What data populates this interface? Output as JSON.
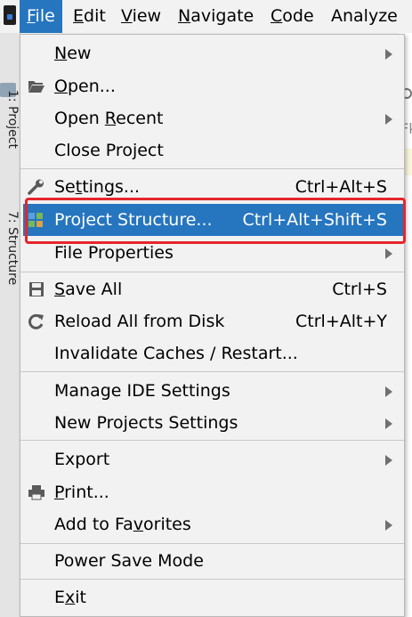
{
  "menubar": {
    "items": [
      {
        "pre": "",
        "u": "F",
        "post": "ile"
      },
      {
        "pre": "",
        "u": "E",
        "post": "dit"
      },
      {
        "pre": "",
        "u": "V",
        "post": "iew"
      },
      {
        "pre": "",
        "u": "N",
        "post": "avigate"
      },
      {
        "pre": "",
        "u": "C",
        "post": "ode"
      },
      {
        "pre": "",
        "u": "",
        "post": "Analyze"
      }
    ],
    "accent": "#2675bf"
  },
  "side": {
    "project_tab": "1: Project",
    "structure_tab": "7: Structure"
  },
  "editor_hints": [
    "Fk"
  ],
  "menu": {
    "items": [
      {
        "pre": "",
        "u": "N",
        "post": "ew",
        "shortcut": "",
        "submenu": true,
        "icon": ""
      },
      {
        "pre": "",
        "u": "O",
        "post": "pen...",
        "shortcut": "",
        "submenu": false,
        "icon": "folder-open-icon"
      },
      {
        "pre": "Open ",
        "u": "R",
        "post": "ecent",
        "shortcut": "",
        "submenu": true,
        "icon": ""
      },
      {
        "pre": "Close Project",
        "u": "",
        "post": "",
        "shortcut": "",
        "submenu": false,
        "icon": ""
      },
      {
        "pre": "Se",
        "u": "t",
        "post": "tings...",
        "shortcut": "Ctrl+Alt+S",
        "submenu": false,
        "icon": "wrench-icon"
      },
      {
        "pre": "Project Structure...",
        "u": "",
        "post": "",
        "shortcut": "Ctrl+Alt+Shift+S",
        "submenu": false,
        "icon": "project-structure-icon",
        "selected": true
      },
      {
        "pre": "File Properties",
        "u": "",
        "post": "",
        "shortcut": "",
        "submenu": true,
        "icon": ""
      },
      {
        "pre": "",
        "u": "S",
        "post": "ave All",
        "shortcut": "Ctrl+S",
        "submenu": false,
        "icon": "save-icon"
      },
      {
        "pre": "Reload All from Disk",
        "u": "",
        "post": "",
        "shortcut": "Ctrl+Alt+Y",
        "submenu": false,
        "icon": "reload-icon"
      },
      {
        "pre": "Invalidate Caches / Restart...",
        "u": "",
        "post": "",
        "shortcut": "",
        "submenu": false,
        "icon": ""
      },
      {
        "pre": "Manage IDE Settings",
        "u": "",
        "post": "",
        "shortcut": "",
        "submenu": true,
        "icon": ""
      },
      {
        "pre": "New Projects Settings",
        "u": "",
        "post": "",
        "shortcut": "",
        "submenu": true,
        "icon": ""
      },
      {
        "pre": "Export",
        "u": "",
        "post": "",
        "shortcut": "",
        "submenu": true,
        "icon": ""
      },
      {
        "pre": "",
        "u": "P",
        "post": "rint...",
        "shortcut": "",
        "submenu": false,
        "icon": "print-icon"
      },
      {
        "pre": "Add to Fa",
        "u": "v",
        "post": "orites",
        "shortcut": "",
        "submenu": true,
        "icon": ""
      },
      {
        "pre": "Power Save Mode",
        "u": "",
        "post": "",
        "shortcut": "",
        "submenu": false,
        "icon": ""
      },
      {
        "pre": "E",
        "u": "x",
        "post": "it",
        "shortcut": "",
        "submenu": false,
        "icon": ""
      }
    ],
    "highlight_color": "#e5262b"
  }
}
